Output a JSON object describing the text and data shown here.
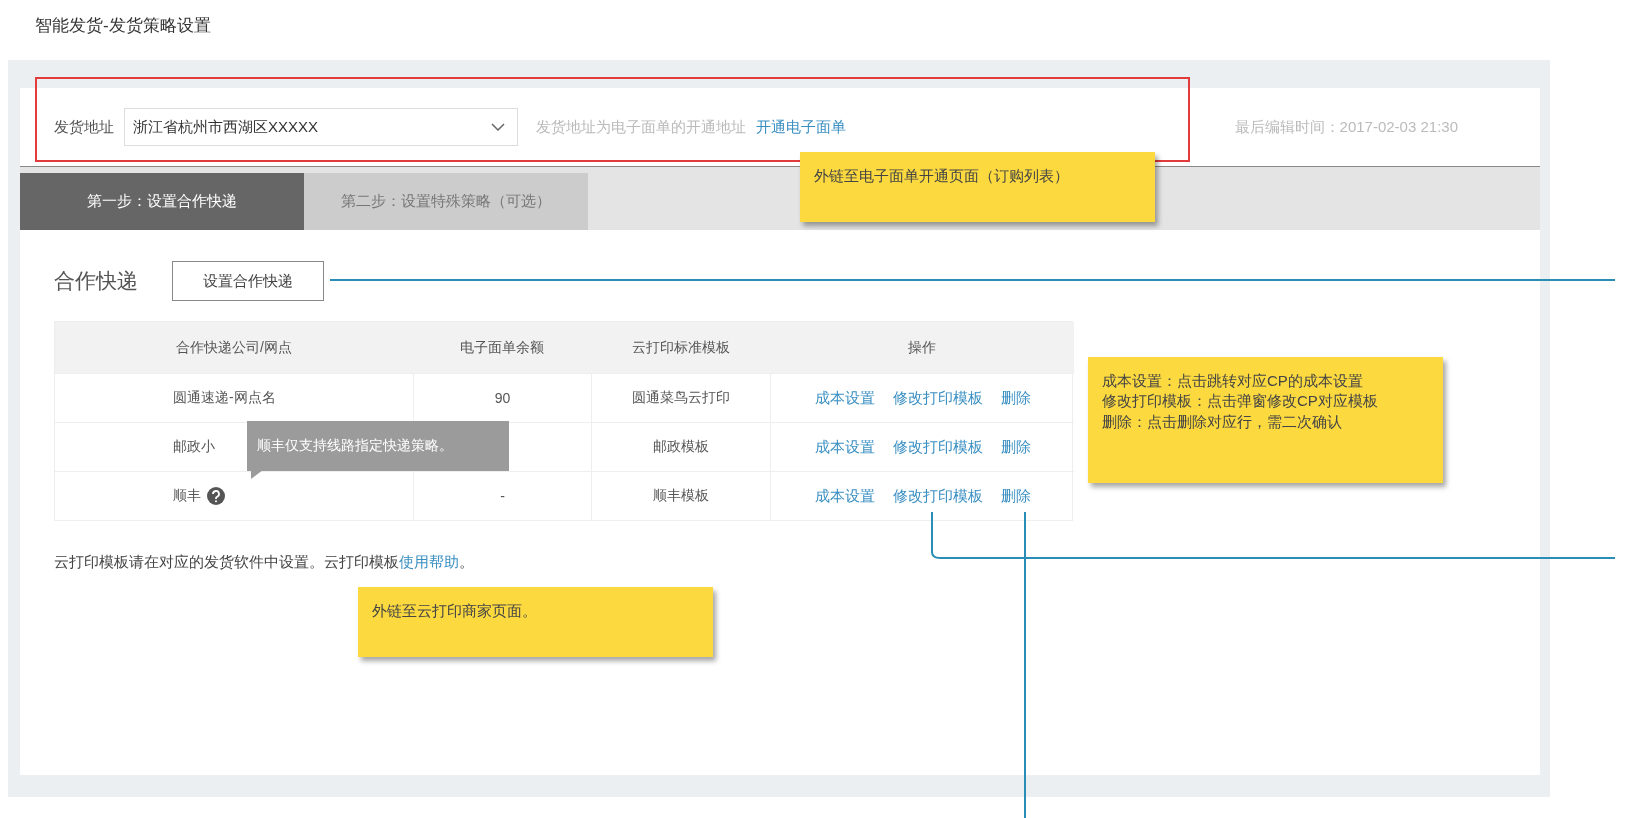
{
  "page_title": "智能发货-发货策略设置",
  "address": {
    "label": "发货地址",
    "value": "浙江省杭州市西湖区XXXXX",
    "hint": "发货地址为电子面单的开通地址",
    "link": "开通电子面单",
    "last_edit": "最后编辑时间：2017-02-03 21:30"
  },
  "steps": [
    {
      "label": "第一步：设置合作快递",
      "selected": true
    },
    {
      "label": "第二步：设置特殊策略（可选）",
      "selected": false
    }
  ],
  "section": {
    "title": "合作快递",
    "button": "设置合作快递"
  },
  "table": {
    "columns": [
      "合作快递公司/网点",
      "电子面单余额",
      "云打印标准模板",
      "操作"
    ],
    "rows": [
      {
        "cells": [
          "圆通速递-网点名",
          "90",
          "圆通菜鸟云打印"
        ],
        "actions": [
          "成本设置",
          "修改打印模板",
          "删除"
        ],
        "help": false
      },
      {
        "cells": [
          "邮政小",
          "",
          "邮政模板"
        ],
        "actions": [
          "成本设置",
          "修改打印模板",
          "删除"
        ],
        "help": false
      },
      {
        "cells": [
          "顺丰",
          "-",
          "顺丰模板"
        ],
        "actions": [
          "成本设置",
          "修改打印模板",
          "删除"
        ],
        "help": true
      }
    ]
  },
  "tooltip": "顺丰仅支持线路指定快递策略。",
  "footer": {
    "text": "云打印模板请在对应的发货软件中设置。云打印模板",
    "link": "使用帮助",
    "end": "。"
  },
  "notes": [
    {
      "lines": [
        "外链至电子面单开通页面（订购列表）"
      ]
    },
    {
      "lines": [
        "成本设置：点击跳转对应CP的成本设置",
        "修改打印模板：点击弹窗修改CP对应模板",
        "删除：点击删除对应行，需二次确认"
      ]
    },
    {
      "lines": [
        "外链至云打印商家页面。"
      ]
    }
  ]
}
